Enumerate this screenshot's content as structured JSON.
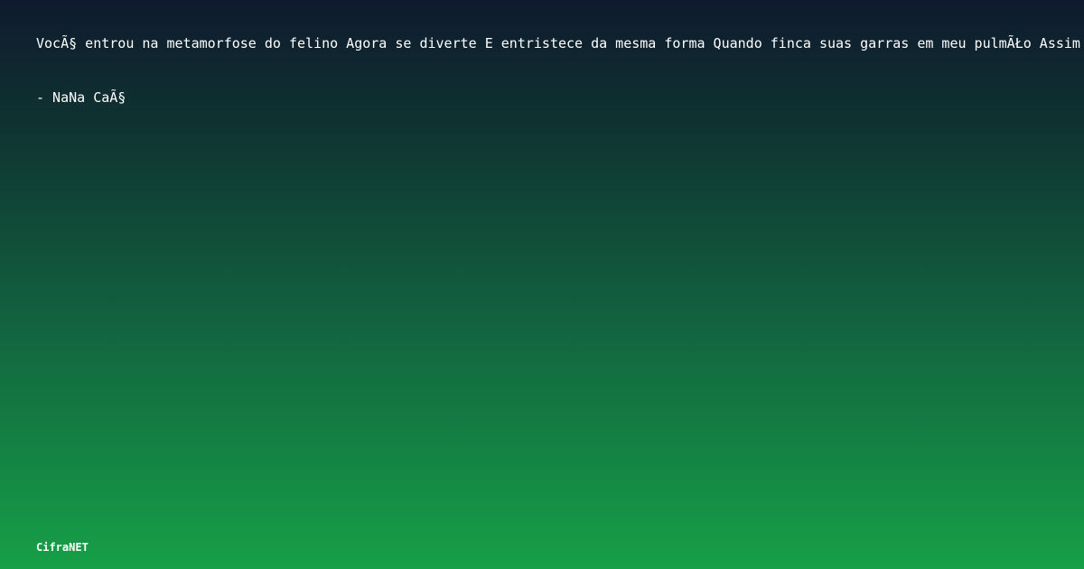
{
  "card": {
    "quote": "VocÃ§ entrou na metamorfose do felino Agora se diverte E entristece da mesma forma Quando finca suas garras em meu pulmÃŁo Assim",
    "author": "- NaNa CaÃ§",
    "brand": "CifraNET"
  },
  "colors": {
    "gradient_top": "#0f1a2e",
    "gradient_bottom": "#16a047",
    "text": "#ffffff"
  }
}
